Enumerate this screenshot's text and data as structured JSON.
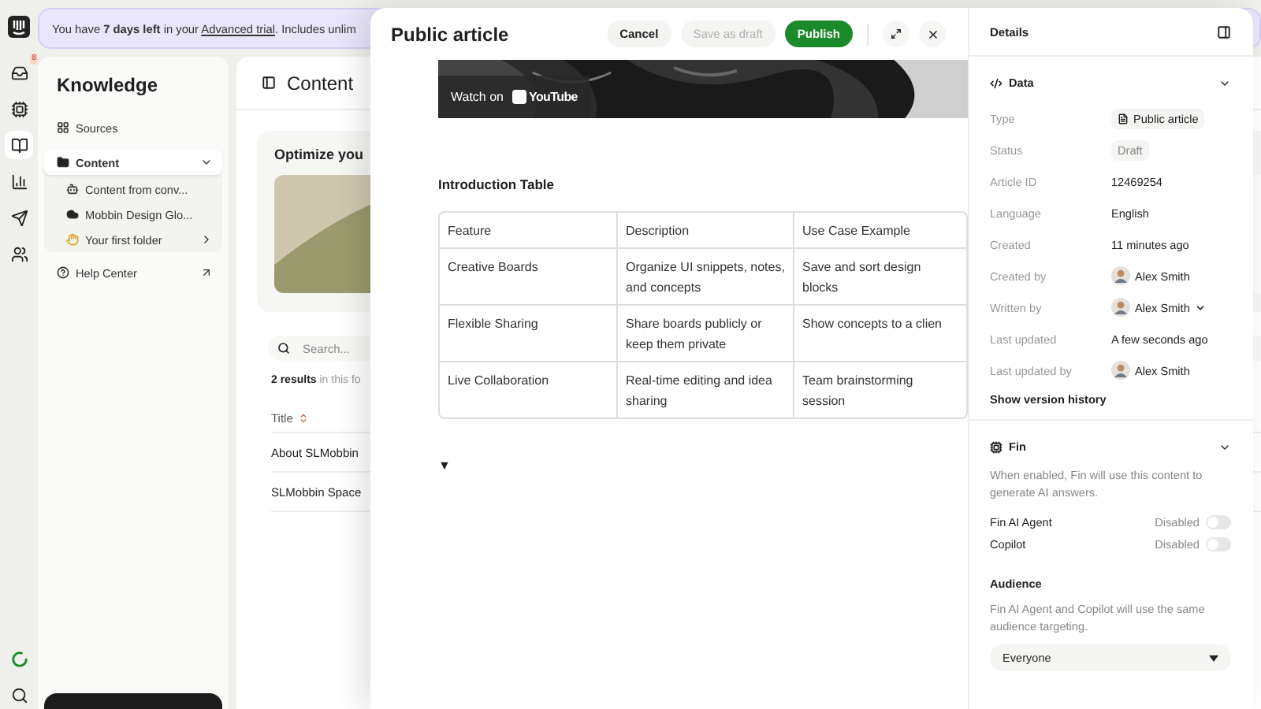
{
  "rail": {
    "items": [
      {
        "kind": "logo",
        "selected": false
      },
      {
        "kind": "inbox",
        "badge": "8",
        "selected": false
      },
      {
        "kind": "fin",
        "selected": false
      },
      {
        "kind": "knowledge",
        "selected": true
      },
      {
        "kind": "reports",
        "selected": false
      },
      {
        "kind": "outbound",
        "selected": false
      },
      {
        "kind": "contacts",
        "selected": false
      }
    ],
    "bottom": [
      {
        "kind": "progress"
      },
      {
        "kind": "search"
      }
    ]
  },
  "banner": {
    "text": "You have **7 days left** in your ",
    "link": "Advanced trial",
    "rest": ". Includes unlim"
  },
  "knowledge": {
    "title": "Knowledge",
    "items": [
      {
        "label": "Sources",
        "kind": "page",
        "selected": false
      },
      {
        "label": "Content",
        "kind": "folder",
        "selected": true,
        "expanded": true,
        "children": [
          {
            "label": "Content from conv...",
            "kind": "page",
            "selected": false
          },
          {
            "label": "Mobbin Design Glo...",
            "kind": "page",
            "selected": false
          },
          {
            "label": "Your first folder",
            "kind": "folder",
            "selected": false,
            "expanded": false
          }
        ]
      },
      {
        "label": "Help Center",
        "kind": "link",
        "selected": false
      }
    ]
  },
  "content": {
    "title": "Content",
    "promo_title": "Optimize you",
    "search": {
      "placeholder": "Search..."
    },
    "results": "**2 results** in this fo",
    "column": "Title",
    "rows": [
      "About SLMobbin",
      "SLMobbin Space"
    ]
  },
  "drawer": {
    "title": "Public article",
    "buttons": [
      {
        "label": "Cancel",
        "kind": "secondary",
        "disabled": false
      },
      {
        "label": "Save as draft",
        "kind": "secondary",
        "disabled": true
      },
      {
        "label": "Publish",
        "kind": "primary",
        "disabled": false
      }
    ],
    "video": {
      "watch_label": "Watch on",
      "brand": "YouTube"
    },
    "heading": "Introduction Table",
    "table": {
      "columns": [
        "Feature",
        "Description",
        "Use Case Example"
      ],
      "rows": [
        [
          "Creative Boards",
          "Organize UI snippets, notes, and concepts",
          "Save and sort design blocks"
        ],
        [
          "Flexible Sharing",
          "Share boards publicly or keep them private",
          "Show concepts to a clien"
        ],
        [
          "Live Collaboration",
          "Real-time editing and idea sharing",
          "Team brainstorming session"
        ]
      ]
    },
    "toggle": "▼"
  },
  "details": {
    "title": "Details",
    "data": {
      "title": "Data",
      "expanded": true,
      "fields": [
        {
          "label": "Type",
          "value": "Public article",
          "kind": "badge"
        },
        {
          "label": "Status",
          "value": "Draft",
          "kind": "status"
        },
        {
          "label": "Article ID",
          "value": "12469254",
          "kind": "plain"
        },
        {
          "label": "Language",
          "value": "English",
          "kind": "plain"
        },
        {
          "label": "Created",
          "value": "11 minutes ago",
          "kind": "plain"
        },
        {
          "label": "Created by",
          "value": "Alex Smith",
          "kind": "person"
        },
        {
          "label": "Written by",
          "value": "Alex Smith",
          "kind": "person-select"
        },
        {
          "label": "Last updated",
          "value": "A few seconds ago",
          "kind": "plain"
        },
        {
          "label": "Last updated by",
          "value": "Alex Smith",
          "kind": "person"
        }
      ],
      "history_link": "Show version history"
    },
    "fin": {
      "title": "Fin",
      "expanded": true,
      "description": "When enabled, Fin will use this content to generate AI answers.",
      "toggles": [
        {
          "label": "Fin AI Agent",
          "status": "Disabled",
          "on": false
        },
        {
          "label": "Copilot",
          "status": "Disabled",
          "on": false
        }
      ],
      "audience_title": "Audience",
      "audience_description": "Fin AI Agent and Copilot will use the same audience targeting.",
      "audience": "Everyone"
    }
  }
}
